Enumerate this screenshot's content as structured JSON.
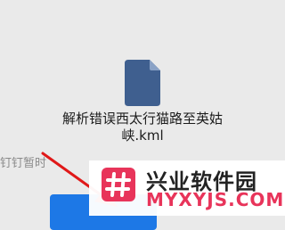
{
  "file": {
    "icon": "document-icon",
    "name": "解析错误西太行猫路至英姑峡.kml",
    "icon_color": "#3f5f8f"
  },
  "hint": {
    "text": "钉钉暂时"
  },
  "open_button": {
    "color": "#1d78e6"
  },
  "arrow": {
    "icon": "arrow-annotation-icon",
    "color": "#e01818"
  },
  "watermark": {
    "title": "兴业软件园",
    "url": "MYXYJS.COM",
    "logo_icon": "hash-logo-icon",
    "accent_color": "#e8345a"
  }
}
